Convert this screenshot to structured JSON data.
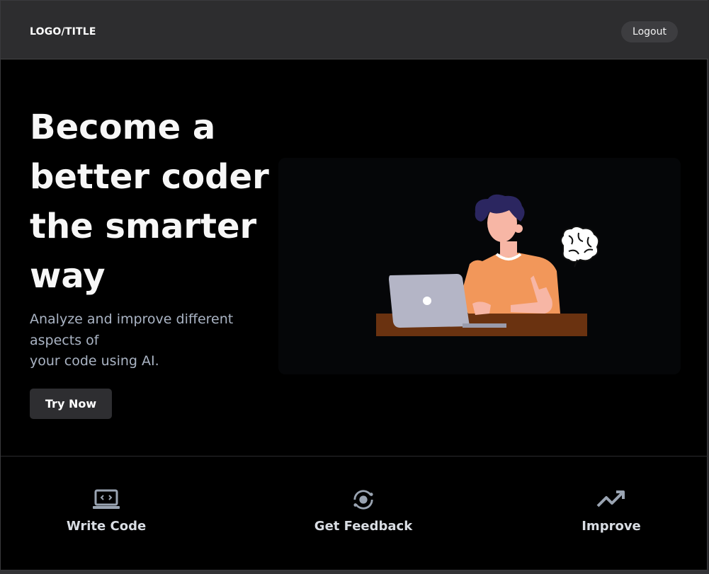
{
  "header": {
    "logo_text": "LOGO/TITLE",
    "logout_label": "Logout"
  },
  "hero": {
    "title": "Become a better coder the smarter way",
    "subtitle_lines": [
      "Analyze and improve different",
      "aspects of",
      "your code using AI."
    ],
    "cta_label": "Try Now"
  },
  "features": [
    {
      "label": "Write Code",
      "icon": "laptop-code-icon"
    },
    {
      "label": "Get Feedback",
      "icon": "feedback-eye-icon"
    },
    {
      "label": "Improve",
      "icon": "trending-up-icon"
    }
  ],
  "colors": {
    "background": "#000000",
    "header": "#2d2d2f",
    "button": "#2e2e31",
    "subtitle": "#aab4c4",
    "icon": "#9aa4b2"
  }
}
